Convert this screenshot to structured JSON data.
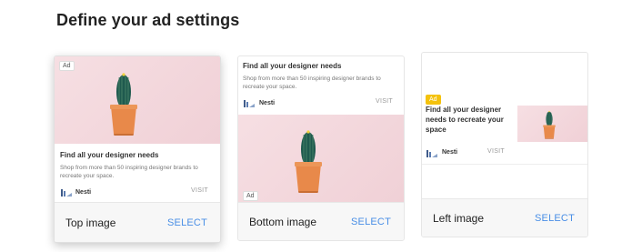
{
  "page": {
    "title": "Define your ad settings"
  },
  "ad": {
    "badge": "Ad",
    "headline": "Find all your designer needs",
    "headline_wrapped": "Find all your designer needs to recreate your space",
    "description": "Shop from more than 50 inspiring designer brands to recreate your space.",
    "brand": "Nesti",
    "cta": "VISIT"
  },
  "options": [
    {
      "label": "Top image",
      "select_label": "SELECT",
      "selected": true
    },
    {
      "label": "Bottom image",
      "select_label": "SELECT",
      "selected": false
    },
    {
      "label": "Left image",
      "select_label": "SELECT",
      "selected": false
    }
  ],
  "icons": {
    "brand_logo": "nesti-logo-icon",
    "product": "cactus-pot-image"
  },
  "colors": {
    "select_blue": "#4a8fe6",
    "ad_badge_yellow": "#f4c20d",
    "photo_pink": "#f3d8dd",
    "pot_orange": "#e8894a",
    "cactus_green": "#1f5a4e"
  }
}
